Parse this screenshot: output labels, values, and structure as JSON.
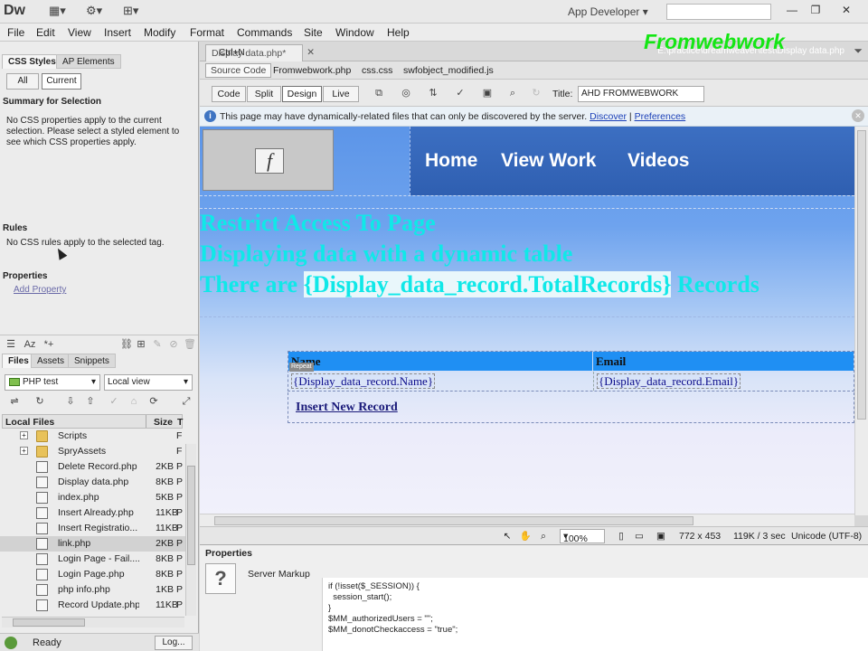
{
  "app": {
    "logo": "Dw",
    "workspace": "App Developer"
  },
  "menu": [
    "File",
    "Edit",
    "View",
    "Insert",
    "Modify",
    "Format",
    "Commands",
    "Site",
    "Window",
    "Help"
  ],
  "left_panel": {
    "tabs": [
      "CSS Styles",
      "AP Elements"
    ],
    "mode_buttons": [
      "All",
      "Current"
    ],
    "summary_title": "Summary for Selection",
    "summary_text": "No CSS properties apply to the current selection.  Please select a styled element to see which CSS properties apply.",
    "rules_title": "Rules",
    "rules_text": "No CSS rules apply to the selected tag.",
    "properties_title": "Properties",
    "add_property": "Add Property"
  },
  "files_panel": {
    "tabs": [
      "Files",
      "Assets",
      "Snippets"
    ],
    "site": "PHP test",
    "view": "Local view",
    "columns": {
      "name": "Local Files",
      "size": "Size",
      "type": "T"
    },
    "items": [
      {
        "name": "Scripts",
        "size": "",
        "type": "F",
        "kind": "folder"
      },
      {
        "name": "SpryAssets",
        "size": "",
        "type": "F",
        "kind": "folder"
      },
      {
        "name": "Delete Record.php",
        "size": "2KB",
        "type": "P",
        "kind": "php"
      },
      {
        "name": "Display data.php",
        "size": "8KB",
        "type": "P",
        "kind": "php"
      },
      {
        "name": "index.php",
        "size": "5KB",
        "type": "P",
        "kind": "php"
      },
      {
        "name": "Insert Already.php",
        "size": "11KB",
        "type": "P",
        "kind": "php"
      },
      {
        "name": "Insert Registratio...",
        "size": "11KB",
        "type": "P",
        "kind": "php"
      },
      {
        "name": "link.php",
        "size": "2KB",
        "type": "P",
        "kind": "php"
      },
      {
        "name": "Login Page - Fail....",
        "size": "8KB",
        "type": "P",
        "kind": "php"
      },
      {
        "name": "Login Page.php",
        "size": "8KB",
        "type": "P",
        "kind": "php"
      },
      {
        "name": "php info.php",
        "size": "1KB",
        "type": "P",
        "kind": "php"
      },
      {
        "name": "Record Update.php",
        "size": "11KB",
        "type": "P",
        "kind": "php"
      }
    ],
    "status": "Ready",
    "log_button": "Log..."
  },
  "document": {
    "tab": "Display data.php*",
    "tab_overlay": "Ctrl+N",
    "path": "E:\\practice\\dreamweaver\\test\\Display data.php",
    "brand": "Fromwebwork",
    "source_code": "Source Code",
    "related_files": [
      "Fromwebwork.php",
      "css.css",
      "swfobject_modified.js"
    ],
    "views": [
      "Code",
      "Split",
      "Design",
      "Live"
    ],
    "title_label": "Title:",
    "title_value": "AHD FROMWEBWORK",
    "info_message": "This page may have dynamically-related files that can only be discovered by the server.",
    "info_discover": "Discover",
    "info_separator": "|",
    "info_preferences": "Preferences"
  },
  "canvas": {
    "nav": [
      "Home",
      "View Work",
      "Videos"
    ],
    "heading1": "Restrict Access To Page",
    "heading2": "Displaying data with a dynamic table",
    "heading3_pre": "There are ",
    "heading3_hl": "{Display_data_record.TotalRecords}",
    "heading3_post": " Records",
    "table": {
      "headers": [
        "Name",
        "Email"
      ],
      "row": [
        "{Display_data_record.Name}",
        "{Display_data_record.Email}"
      ],
      "repeat_tag": "Repeat"
    },
    "insert_link": "Insert New Record"
  },
  "status_bar": {
    "zoom": "100%",
    "size": "772 x 453",
    "weight": "119K / 3 sec",
    "encoding": "Unicode (UTF-8)"
  },
  "properties": {
    "title": "Properties",
    "label": "Server Markup",
    "code": "if (!isset($_SESSION)) {\n  session_start();\n}\n$MM_authorizedUsers = \"\";\n$MM_donotCheckaccess = \"true\";"
  }
}
